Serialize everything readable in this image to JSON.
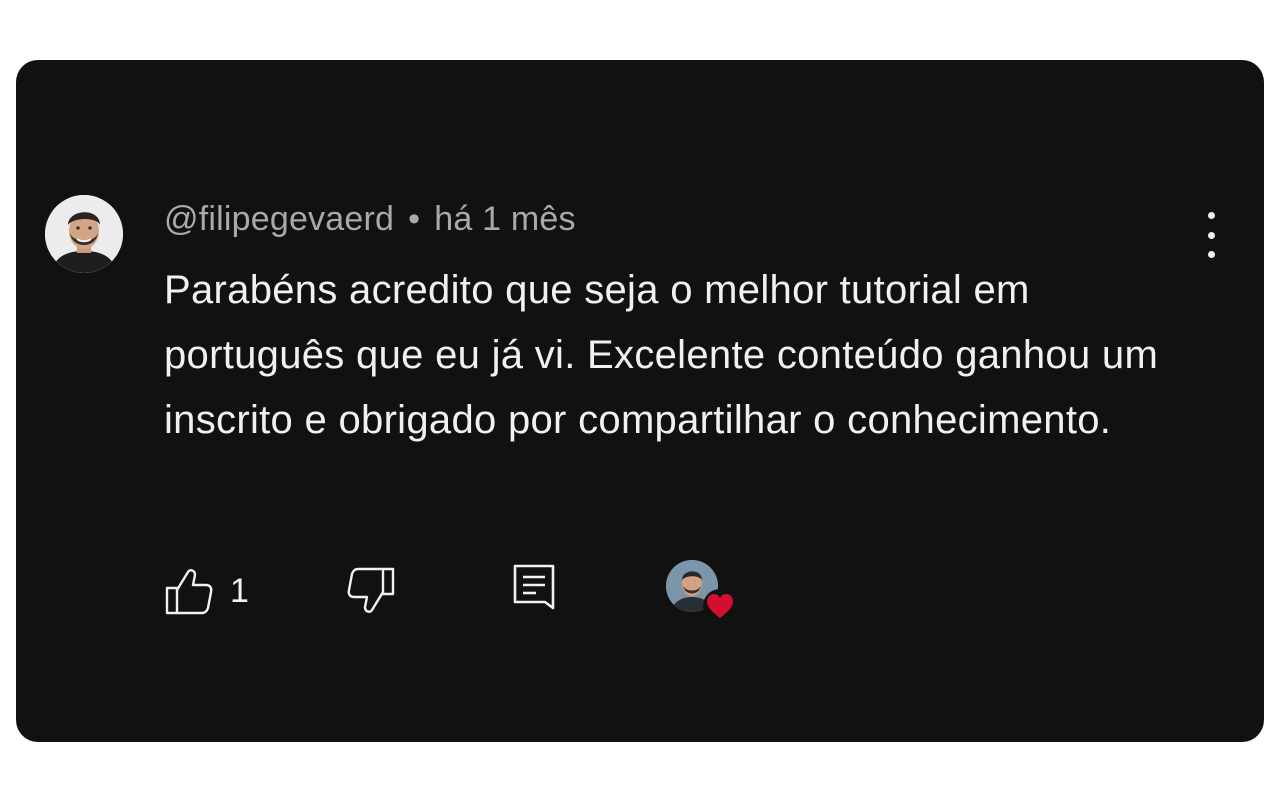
{
  "comment": {
    "author": "@filipegevaerd",
    "separator": "•",
    "timestamp": "há 1 mês",
    "text": "Parabéns acredito que seja o melhor tutorial em português que eu já vi. Excelente conteúdo ganhou um inscrito e obrigado por compartilhar o conhecimento.",
    "like_count": "1",
    "icons": {
      "like": "thumb-up-icon",
      "dislike": "thumb-down-icon",
      "reply": "comment-reply-icon",
      "menu": "more-vertical-icon",
      "heart": "heart-icon"
    }
  },
  "colors": {
    "card_background": "#111111",
    "text_primary": "#f1f1f1",
    "text_secondary": "#a9a9a9",
    "heart": "#d20f2f"
  }
}
